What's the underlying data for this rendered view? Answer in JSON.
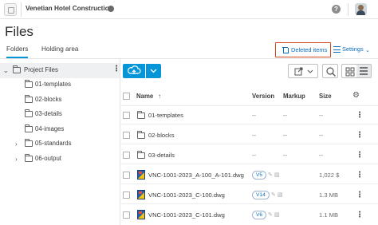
{
  "header": {
    "project_name": "Venetian Hotel Construction",
    "help_label": "?"
  },
  "page": {
    "title": "Files",
    "tabs": [
      {
        "label": "Folders",
        "active": true
      },
      {
        "label": "Holding area",
        "active": false
      }
    ],
    "deleted_items_label": "Deleted items",
    "settings_label": "Settings"
  },
  "tree": {
    "root": {
      "label": "Project Files",
      "expanded": true
    },
    "children": [
      {
        "label": "01-templates",
        "expandable": false
      },
      {
        "label": "02-blocks",
        "expandable": false
      },
      {
        "label": "03-details",
        "expandable": false
      },
      {
        "label": "04-images",
        "expandable": false
      },
      {
        "label": "05-standards",
        "expandable": true
      },
      {
        "label": "06-output",
        "expandable": true
      }
    ]
  },
  "table": {
    "columns": {
      "name": "Name",
      "version": "Version",
      "markup": "Markup",
      "size": "Size"
    },
    "sort_arrow": "↑",
    "rows": [
      {
        "type": "folder",
        "name": "01-templates",
        "version": "--",
        "markup": "--",
        "size": "--"
      },
      {
        "type": "folder",
        "name": "02-blocks",
        "version": "--",
        "markup": "--",
        "size": "--"
      },
      {
        "type": "folder",
        "name": "03-details",
        "version": "--",
        "markup": "--",
        "size": "--"
      },
      {
        "type": "dwg",
        "name": "VNC-1001-2023_A-100_A-101.dwg",
        "version": "V5",
        "markup": "",
        "size": "1,022 $"
      },
      {
        "type": "dwg",
        "name": "VNC-1001-2023_C-100.dwg",
        "version": "V14",
        "markup": "",
        "size": "1.3 MB"
      },
      {
        "type": "dwg",
        "name": "VNC-1001-2023_C-101.dwg",
        "version": "V6",
        "markup": "",
        "size": "1.1 MB"
      }
    ]
  },
  "colors": {
    "accent": "#0696d7",
    "link": "#0a6ebd",
    "highlight_border": "#d1491b"
  },
  "icons": {
    "upload": "cloud-upload-icon",
    "export": "export-icon",
    "search": "search-icon",
    "grid_view": "grid-view-icon",
    "list_view": "list-view-icon",
    "settings": "gear-icon"
  }
}
